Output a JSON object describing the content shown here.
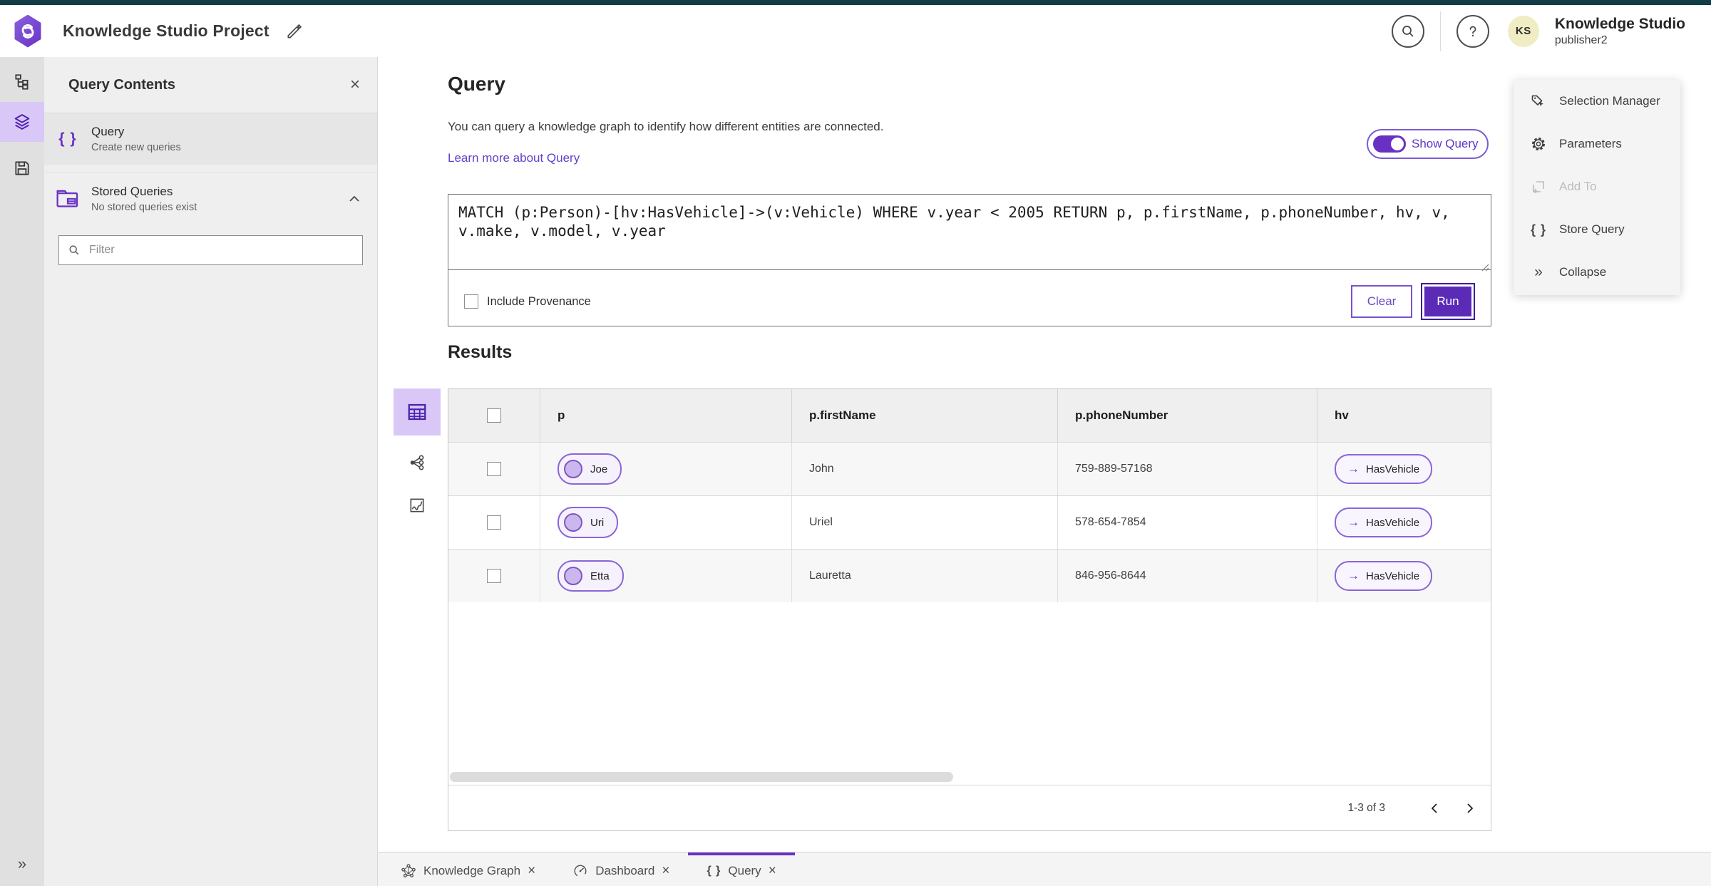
{
  "topbar": {
    "project_title": "Knowledge Studio Project",
    "app_name": "Knowledge Studio",
    "username": "publisher2",
    "avatar_initials": "KS"
  },
  "left_panel": {
    "title": "Query Contents",
    "items": [
      {
        "label": "Query",
        "sublabel": "Create new queries"
      },
      {
        "label": "Stored Queries",
        "sublabel": "No stored queries exist"
      }
    ],
    "filter_placeholder": "Filter"
  },
  "query_section": {
    "title": "Query",
    "description": "You can query a knowledge graph to identify how different entities are connected.",
    "learn_more": "Learn more about Query",
    "show_query_label": "Show Query",
    "query_text": "MATCH (p:Person)-[hv:HasVehicle]->(v:Vehicle) WHERE v.year < 2005 RETURN p, p.firstName, p.phoneNumber, hv, v, v.make, v.model, v.year",
    "include_provenance_label": "Include Provenance",
    "clear_label": "Clear",
    "run_label": "Run"
  },
  "results": {
    "title": "Results",
    "columns": [
      "p",
      "p.firstName",
      "p.phoneNumber",
      "hv"
    ],
    "rows": [
      {
        "p": "Joe",
        "firstName": "John",
        "phoneNumber": "759-889-57168",
        "hv": "HasVehicle"
      },
      {
        "p": "Uri",
        "firstName": "Uriel",
        "phoneNumber": "578-654-7854",
        "hv": "HasVehicle"
      },
      {
        "p": "Etta",
        "firstName": "Lauretta",
        "phoneNumber": "846-956-8644",
        "hv": "HasVehicle"
      }
    ],
    "pagination": "1-3 of 3"
  },
  "right_menu": {
    "items": [
      {
        "label": "Selection Manager"
      },
      {
        "label": "Parameters"
      },
      {
        "label": "Add To"
      },
      {
        "label": "Store Query"
      },
      {
        "label": "Collapse"
      }
    ]
  },
  "bottom_tabs": [
    {
      "label": "Knowledge Graph"
    },
    {
      "label": "Dashboard"
    },
    {
      "label": "Query"
    }
  ],
  "glyphs": {
    "close": "×",
    "collapse": "»",
    "braces": "{ }",
    "arrow": "→"
  },
  "colors": {
    "primary_purple": "#6930c3",
    "run_button": "#5b2bb8",
    "accent_light_purple": "#d9c8f7",
    "teal_strip": "#123c46",
    "avatar_bg": "#f0edc4",
    "link": "#6141c9"
  }
}
